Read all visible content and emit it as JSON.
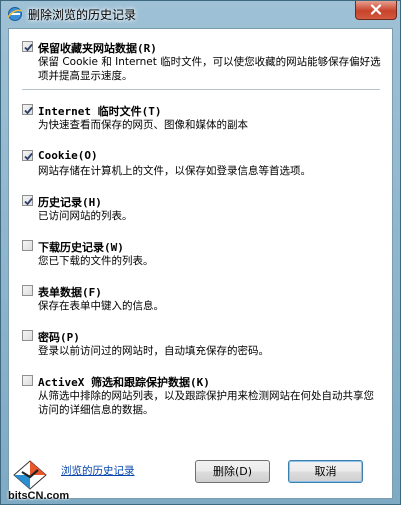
{
  "window": {
    "title": "删除浏览的历史记录",
    "close_symbol": "×"
  },
  "options": [
    {
      "label": "保留收藏夹网站数据(R)",
      "description": "保留 Cookie 和 Internet 临时文件，可以使您收藏的网站能够保存偏好选项并提高显示速度。",
      "checked": true
    },
    {
      "label": "Internet 临时文件(T)",
      "description": "为快速查看而保存的网页、图像和媒体的副本",
      "checked": true
    },
    {
      "label": "Cookie(O)",
      "description": "网站存储在计算机上的文件，以保存如登录信息等首选项。",
      "checked": true
    },
    {
      "label": "历史记录(H)",
      "description": "已访问网站的列表。",
      "checked": true
    },
    {
      "label": "下载历史记录(W)",
      "description": "您已下载的文件的列表。",
      "checked": false
    },
    {
      "label": "表单数据(F)",
      "description": "保存在表单中键入的信息。",
      "checked": false
    },
    {
      "label": "密码(P)",
      "description": "登录以前访问过的网站时，自动填充保存的密码。",
      "checked": false
    },
    {
      "label": "ActiveX 筛选和跟踪保护数据(K)",
      "description": "从筛选中排除的网站列表，以及跟踪保护用来检测网站在何处自动共享您访问的详细信息的数据。",
      "checked": false
    }
  ],
  "footer": {
    "link_label": "浏览的历史记录",
    "delete_label": "删除(D)",
    "cancel_label": "取消"
  },
  "watermark": {
    "text": "bitsCN.com"
  },
  "colors": {
    "frame": "#9fc1d6",
    "link": "#0645ad"
  }
}
